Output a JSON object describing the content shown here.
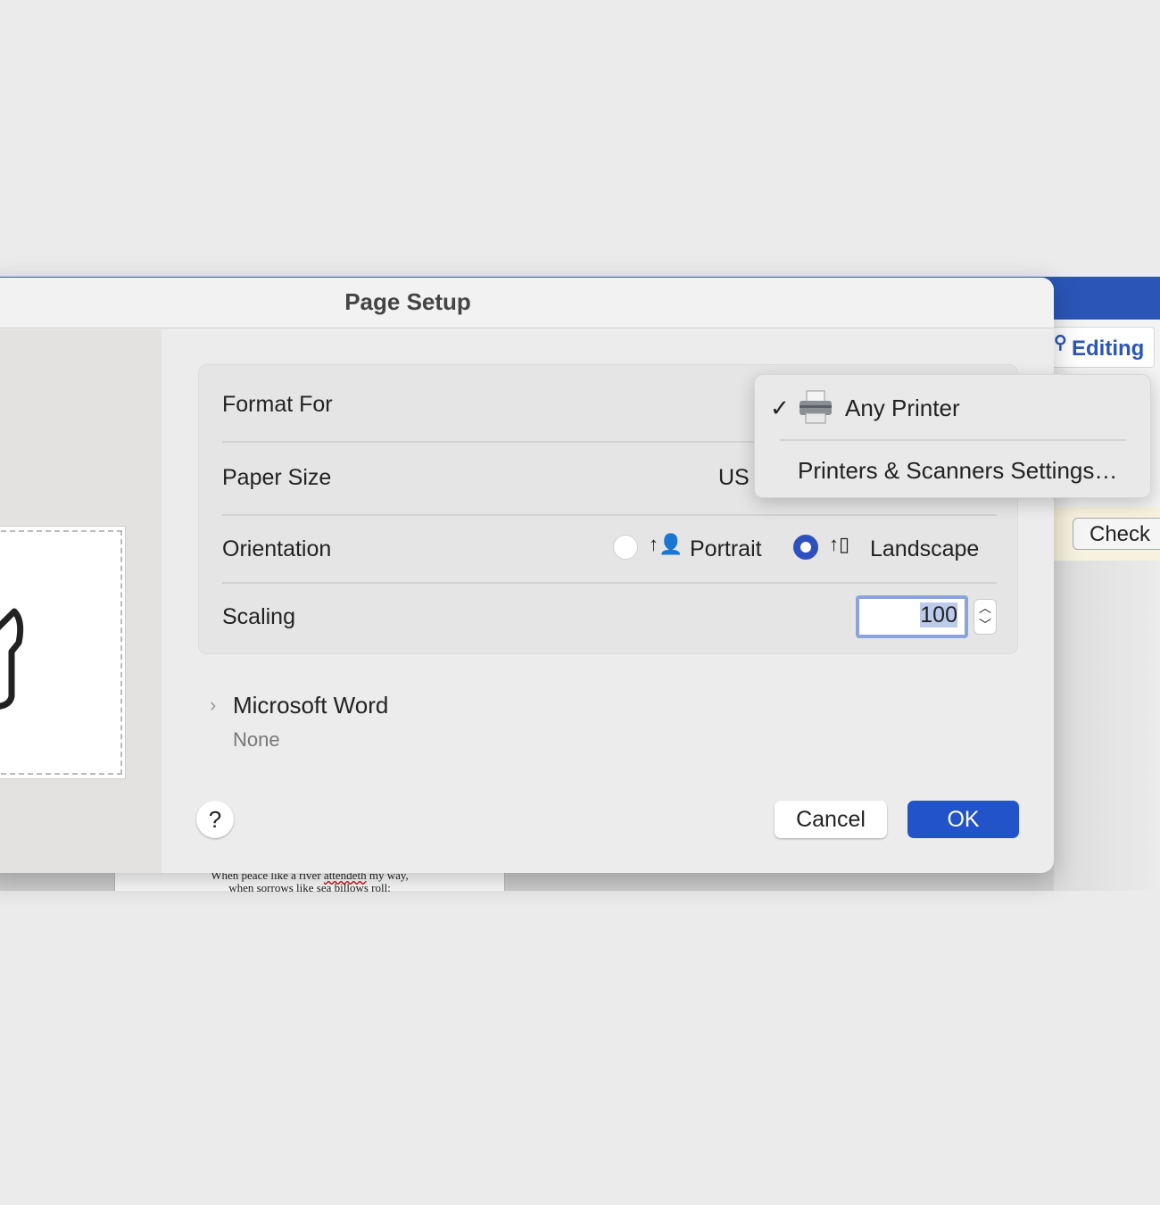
{
  "word": {
    "editing_label": "Editing",
    "check_label": "Check",
    "document_lines": [
      "When peace like a river",
      "attendeth",
      "my way,",
      "when sorrows like sea billows roll:"
    ]
  },
  "dialog": {
    "title": "Page Setup",
    "format_for_label": "Format For",
    "paper_size_label": "Paper Size",
    "paper_size_value": "US Le",
    "orientation_label": "Orientation",
    "orientation_options": [
      {
        "label": "Portrait",
        "selected": false
      },
      {
        "label": "Landscape",
        "selected": true
      }
    ],
    "scaling_label": "Scaling",
    "scaling_value": "100",
    "section_label": "Microsoft Word",
    "section_value": "None",
    "help_label": "?",
    "cancel_label": "Cancel",
    "ok_label": "OK"
  },
  "format_menu": {
    "items": [
      {
        "label": "Any Printer",
        "checked": true,
        "icon": "printer-icon"
      },
      {
        "label": "Printers & Scanners Settings…",
        "checked": false
      }
    ],
    "check_glyph": "✓"
  },
  "colors": {
    "accent": "#2353c8",
    "ribbon": "#2b56b8"
  }
}
